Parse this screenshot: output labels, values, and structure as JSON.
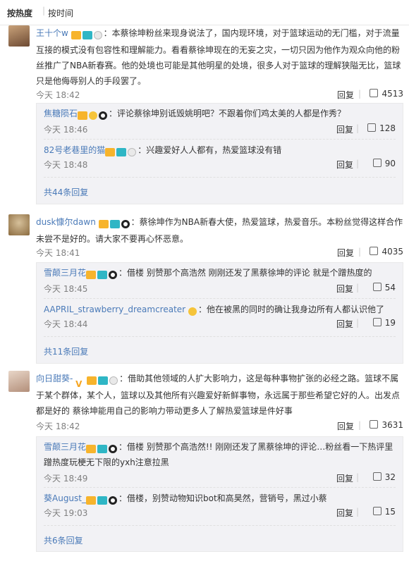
{
  "sort": {
    "hot": "按热度",
    "sep": "|",
    "time": "按时间"
  },
  "comments": [
    {
      "user": "王十个w",
      "text": "：本蔡徐坤粉丝来现身说法了，国内现环境，对于篮球运动的无门槛，对于流量互接的模式没有包容性和理解能力。看看蔡徐坤现在的无妄之灾，一切只因为他作为观众向他的粉丝推广了NBA新春赛。他的处境也可能是其他明星的处境，很多人对于篮球的理解狭隘无比，篮球只是他侮辱别人的手段罢了。",
      "time": "今天 18:42",
      "reply": "回复",
      "likes": "4513",
      "replies": [
        {
          "user": "焦糖陨石",
          "text": "：评论蔡徐坤别诋毁姚明吧？不跟着你们鸡太美的人都是作秀？",
          "time": "今天 18:46",
          "reply": "回复",
          "likes": "128"
        },
        {
          "user": "82号老巷里的猫",
          "text": "：兴趣爱好人人都有，热爱篮球没有错",
          "time": "今天 18:48",
          "reply": "回复",
          "likes": "90"
        }
      ],
      "more": "共44条回复"
    },
    {
      "user": "dusk慷尔dawn",
      "text": "：蔡徐坤作为NBA新春大使，热爱篮球，热爱音乐。本粉丝觉得这样合作未尝不是好的。请大家不要再心怀恶意。",
      "time": "今天 18:41",
      "reply": "回复",
      "likes": "4035",
      "replies": [
        {
          "user": "雪颠三月花",
          "text": "：借楼 别赞那个高浩然 刚刚还发了黑蔡徐坤的评论 就是个蹭热度的",
          "time": "今天 18:45",
          "reply": "回复",
          "likes": "54"
        },
        {
          "user": "AAPRIL_strawberry_dreamcreater",
          "text": "：他在被黑的同时的确让我身边所有人都认识他了",
          "time": "今天 18:44",
          "reply": "回复",
          "likes": "19"
        }
      ],
      "more": "共11条回复"
    },
    {
      "user": "向日甜葵-",
      "text": "：借助其他领域的人扩大影响力，这是每种事物扩张的必经之路。篮球不属于某个群体，某个人，篮球以及其他所有兴趣爱好新鲜事物，永远属于那些希望它好的人。出发点都是好的 蔡徐坤能用自己的影响力带动更多人了解热爱篮球是件好事",
      "time": "今天 18:42",
      "reply": "回复",
      "likes": "3631",
      "replies": [
        {
          "user": "雪颠三月花",
          "text": "：借楼 别赞那个高浩然!! 刚刚还发了黑蔡徐坤的评论…粉丝看一下热评里蹭热度玩梗无下限的yxh注意拉黑",
          "time": "今天 18:49",
          "reply": "回复",
          "likes": "32"
        },
        {
          "user": "葵August_",
          "text": "：借楼，别赞动物知识bot和高昊然，营销号，黑过小蔡",
          "time": "今天 19:03",
          "reply": "回复",
          "likes": "15"
        }
      ],
      "more": "共6条回复"
    }
  ]
}
